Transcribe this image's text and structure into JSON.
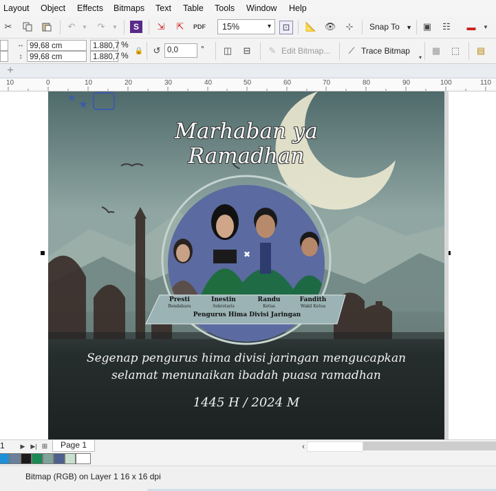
{
  "menubar": {
    "items": [
      "Layout",
      "Object",
      "Effects",
      "Bitmaps",
      "Text",
      "Table",
      "Tools",
      "Window",
      "Help"
    ]
  },
  "toolbar": {
    "zoom_value": "15%",
    "snap_to_label": "Snap To"
  },
  "property_bar": {
    "width_value": "99,68 cm",
    "height_value": "99,68 cm",
    "scale_x_value": "1.880,7",
    "scale_y_value": "1.880,7",
    "percent_x": "%",
    "percent_y": "%",
    "rotation_value": "0,0",
    "degree_symbol": "°",
    "edit_bitmap_label": "Edit Bitmap...",
    "trace_bitmap_label": "Trace Bitmap"
  },
  "ruler": {
    "ticks": [
      "10",
      "0",
      "10",
      "20",
      "30",
      "40",
      "50",
      "60",
      "70",
      "80",
      "90",
      "100",
      "110"
    ]
  },
  "poster": {
    "title": "Marhaban ya Ramadhan",
    "members": [
      {
        "name": "Presti",
        "role": "Bendahara"
      },
      {
        "name": "Inestin",
        "role": "Sekretaris"
      },
      {
        "name": "Randu",
        "role": "Ketua"
      },
      {
        "name": "Fandith",
        "role": "Wakil Ketua"
      }
    ],
    "group_label": "Pengurus Hima Divisi Jaringan",
    "message_line1": "Segenap pengurus hima divisi jaringan mengucapkan",
    "message_line2": "selamat menunaikan ibadah puasa ramadhan",
    "year": "1445 H / 2024 M"
  },
  "pagebar": {
    "page_number": "1",
    "page_tab_label": "Page 1"
  },
  "palette": {
    "colors": [
      "#1e90d8",
      "#6a7f99",
      "#1b1b1b",
      "#1a8a55",
      "#7fa39a",
      "#4d5f8c",
      "#c8e0d0",
      "#ffffff"
    ]
  },
  "status": {
    "text": "Bitmap (RGB) on Layer 1 16 x 16 dpi"
  }
}
